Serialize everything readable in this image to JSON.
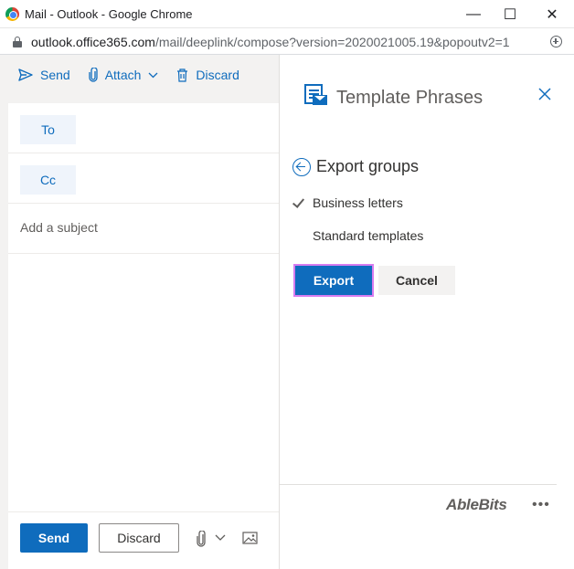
{
  "browser": {
    "window_title": "Mail - Outlook - Google Chrome",
    "url_host": "outlook.office365.com",
    "url_path": "/mail/deeplink/compose?version=2020021005.19&popoutv2=1",
    "minimize_glyph": "—",
    "maximize_glyph": "☐",
    "close_glyph": "✕"
  },
  "compose": {
    "toolbar": {
      "send_label": "Send",
      "attach_label": "Attach",
      "discard_label": "Discard"
    },
    "to_label": "To",
    "cc_label": "Cc",
    "subject_placeholder": "Add a subject",
    "bottom": {
      "send_label": "Send",
      "discard_label": "Discard"
    }
  },
  "pane": {
    "title": "Template Phrases",
    "back_label": "Export groups",
    "groups": [
      {
        "label": "Business letters",
        "checked": true
      },
      {
        "label": "Standard templates",
        "checked": false
      }
    ],
    "export_label": "Export",
    "cancel_label": "Cancel",
    "brand": "AbleBits",
    "more_glyph": "•••"
  },
  "colors": {
    "accent": "#0f6cbd",
    "focus_outline": "#d77cf0",
    "compose_bg": "#f3f2f1"
  },
  "icons": [
    "chrome-logo-icon",
    "lock-icon",
    "add-icon",
    "send-icon",
    "attach-icon",
    "trash-icon",
    "template-phrases-logo-icon",
    "close-icon",
    "back-arrow-icon",
    "check-icon",
    "paperclip-icon",
    "chevron-down-icon",
    "image-icon",
    "more-icon"
  ]
}
